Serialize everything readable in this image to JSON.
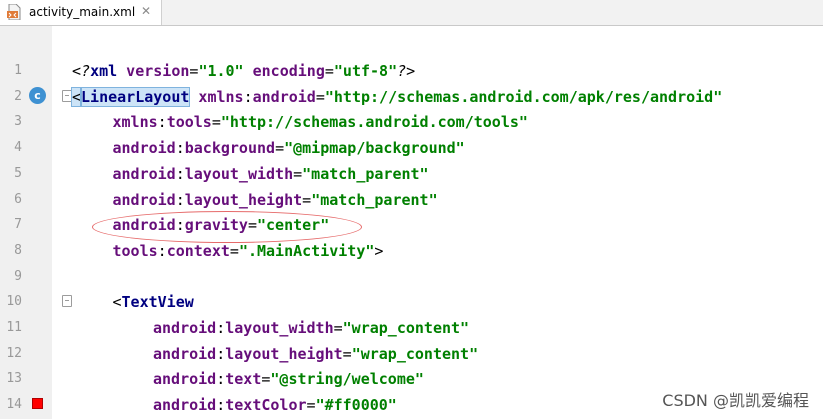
{
  "tab": {
    "title": "activity_main.xml",
    "close_glyph": "✕"
  },
  "gutter": {
    "class_marker_letter": "c",
    "swatch_color": "#ff0000"
  },
  "lines": [
    {
      "n": "1",
      "indent": 0,
      "parts": [
        {
          "t": "<?",
          "c": "pi"
        },
        {
          "t": "xml",
          "c": "tag"
        },
        {
          "t": " version",
          "c": "attr"
        },
        {
          "t": "=",
          "c": "punct"
        },
        {
          "t": "\"1.0\"",
          "c": "val"
        },
        {
          "t": " encoding",
          "c": "attr"
        },
        {
          "t": "=",
          "c": "punct"
        },
        {
          "t": "\"utf-8\"",
          "c": "val"
        },
        {
          "t": "?>",
          "c": "pi"
        }
      ]
    },
    {
      "n": "2",
      "indent": 0,
      "parts": [
        {
          "t": "<",
          "c": "punct highlight"
        },
        {
          "t": "LinearLayout",
          "c": "tag highlight"
        },
        {
          "t": " xmlns",
          "c": "attr"
        },
        {
          "t": ":",
          "c": "punct"
        },
        {
          "t": "android",
          "c": "ns"
        },
        {
          "t": "=",
          "c": "punct"
        },
        {
          "t": "\"http://schemas.android.com/apk/res/android\"",
          "c": "val"
        }
      ]
    },
    {
      "n": "3",
      "indent": 1,
      "parts": [
        {
          "t": "xmlns",
          "c": "attr"
        },
        {
          "t": ":",
          "c": "punct"
        },
        {
          "t": "tools",
          "c": "ns"
        },
        {
          "t": "=",
          "c": "punct"
        },
        {
          "t": "\"http://schemas.android.com/tools\"",
          "c": "val"
        }
      ]
    },
    {
      "n": "4",
      "indent": 1,
      "parts": [
        {
          "t": "android",
          "c": "ns"
        },
        {
          "t": ":",
          "c": "punct"
        },
        {
          "t": "background",
          "c": "attr"
        },
        {
          "t": "=",
          "c": "punct"
        },
        {
          "t": "\"@mipmap/background\"",
          "c": "val"
        }
      ]
    },
    {
      "n": "5",
      "indent": 1,
      "parts": [
        {
          "t": "android",
          "c": "ns"
        },
        {
          "t": ":",
          "c": "punct"
        },
        {
          "t": "layout_width",
          "c": "attr"
        },
        {
          "t": "=",
          "c": "punct"
        },
        {
          "t": "\"match_parent\"",
          "c": "val"
        }
      ]
    },
    {
      "n": "6",
      "indent": 1,
      "parts": [
        {
          "t": "android",
          "c": "ns"
        },
        {
          "t": ":",
          "c": "punct"
        },
        {
          "t": "layout_height",
          "c": "attr"
        },
        {
          "t": "=",
          "c": "punct"
        },
        {
          "t": "\"match_parent\"",
          "c": "val"
        }
      ]
    },
    {
      "n": "7",
      "indent": 1,
      "parts": [
        {
          "t": "android",
          "c": "ns"
        },
        {
          "t": ":",
          "c": "punct"
        },
        {
          "t": "gravity",
          "c": "attr"
        },
        {
          "t": "=",
          "c": "punct"
        },
        {
          "t": "\"center\"",
          "c": "val"
        }
      ]
    },
    {
      "n": "8",
      "indent": 1,
      "parts": [
        {
          "t": "tools",
          "c": "ns"
        },
        {
          "t": ":",
          "c": "punct"
        },
        {
          "t": "context",
          "c": "attr"
        },
        {
          "t": "=",
          "c": "punct"
        },
        {
          "t": "\".MainActivity\"",
          "c": "val"
        },
        {
          "t": ">",
          "c": "punct"
        }
      ]
    },
    {
      "n": "9",
      "indent": 0,
      "parts": []
    },
    {
      "n": "10",
      "indent": 1,
      "parts": [
        {
          "t": "<",
          "c": "punct"
        },
        {
          "t": "TextView",
          "c": "tag"
        }
      ]
    },
    {
      "n": "11",
      "indent": 2,
      "parts": [
        {
          "t": "android",
          "c": "ns"
        },
        {
          "t": ":",
          "c": "punct"
        },
        {
          "t": "layout_width",
          "c": "attr"
        },
        {
          "t": "=",
          "c": "punct"
        },
        {
          "t": "\"wrap_content\"",
          "c": "val"
        }
      ]
    },
    {
      "n": "12",
      "indent": 2,
      "parts": [
        {
          "t": "android",
          "c": "ns"
        },
        {
          "t": ":",
          "c": "punct"
        },
        {
          "t": "layout_height",
          "c": "attr"
        },
        {
          "t": "=",
          "c": "punct"
        },
        {
          "t": "\"wrap_content\"",
          "c": "val"
        }
      ]
    },
    {
      "n": "13",
      "indent": 2,
      "parts": [
        {
          "t": "android",
          "c": "ns"
        },
        {
          "t": ":",
          "c": "punct"
        },
        {
          "t": "text",
          "c": "attr"
        },
        {
          "t": "=",
          "c": "punct"
        },
        {
          "t": "\"@string/welcome\"",
          "c": "val"
        }
      ]
    },
    {
      "n": "14",
      "indent": 2,
      "parts": [
        {
          "t": "android",
          "c": "ns"
        },
        {
          "t": ":",
          "c": "punct"
        },
        {
          "t": "textColor",
          "c": "attr"
        },
        {
          "t": "=",
          "c": "punct"
        },
        {
          "t": "\"#ff0000\"",
          "c": "val"
        }
      ]
    }
  ],
  "watermark": "CSDN @凯凯爱编程"
}
